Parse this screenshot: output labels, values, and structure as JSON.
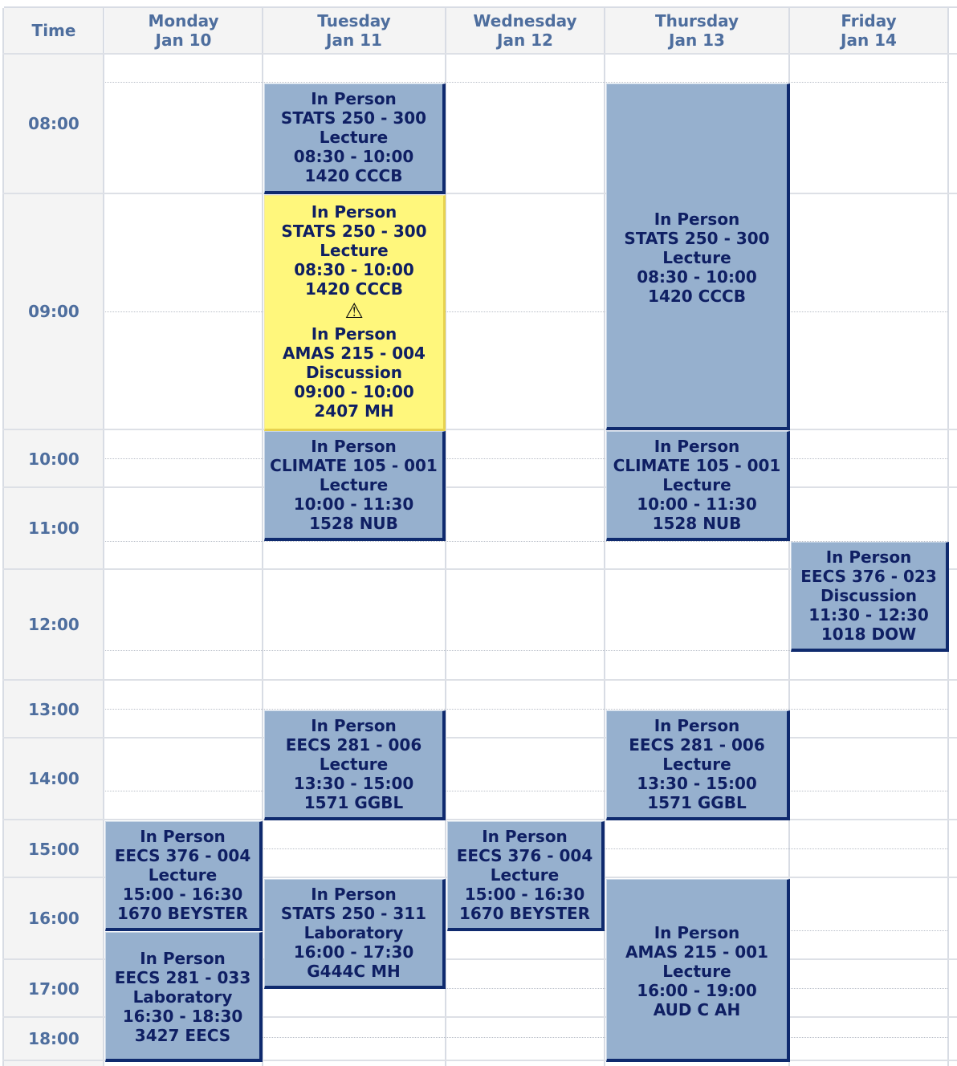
{
  "header": {
    "time_label": "Time",
    "days": [
      {
        "name": "Monday",
        "date": "Jan 10"
      },
      {
        "name": "Tuesday",
        "date": "Jan 11"
      },
      {
        "name": "Wednesday",
        "date": "Jan 12"
      },
      {
        "name": "Thursday",
        "date": "Jan 13"
      },
      {
        "name": "Friday",
        "date": "Jan 14"
      }
    ]
  },
  "time_labels": [
    "08:00",
    "09:00",
    "10:00",
    "11:00",
    "12:00",
    "13:00",
    "14:00",
    "15:00",
    "16:00",
    "17:00",
    "18:00"
  ],
  "events": [
    {
      "mode": "In Person",
      "course": "STATS 250 - 300",
      "type": "Lecture",
      "time": "08:30 - 10:00",
      "room": "1420 CCCB"
    },
    {
      "mode": "In Person",
      "course": "STATS 250 - 300",
      "type": "Lecture",
      "time": "08:30 - 10:00",
      "room": "1420 CCCB"
    },
    {
      "mode": "In Person",
      "course": "STATS 250 - 300",
      "type": "Lecture",
      "time": "08:30 - 10:00",
      "room": "1420 CCCB"
    },
    {
      "mode": "In Person",
      "course": "AMAS 215 - 004",
      "type": "Discussion",
      "time": "09:00 - 10:00",
      "room": "2407 MH"
    },
    {
      "mode": "In Person",
      "course": "CLIMATE 105 - 001",
      "type": "Lecture",
      "time": "10:00 - 11:30",
      "room": "1528 NUB"
    },
    {
      "mode": "In Person",
      "course": "CLIMATE 105 - 001",
      "type": "Lecture",
      "time": "10:00 - 11:30",
      "room": "1528 NUB"
    },
    {
      "mode": "In Person",
      "course": "EECS 376 - 023",
      "type": "Discussion",
      "time": "11:30 - 12:30",
      "room": "1018 DOW"
    },
    {
      "mode": "In Person",
      "course": "EECS 281 - 006",
      "type": "Lecture",
      "time": "13:30 - 15:00",
      "room": "1571 GGBL"
    },
    {
      "mode": "In Person",
      "course": "EECS 281 - 006",
      "type": "Lecture",
      "time": "13:30 - 15:00",
      "room": "1571 GGBL"
    },
    {
      "mode": "In Person",
      "course": "EECS 376 - 004",
      "type": "Lecture",
      "time": "15:00 - 16:30",
      "room": "1670 BEYSTER"
    },
    {
      "mode": "In Person",
      "course": "EECS 376 - 004",
      "type": "Lecture",
      "time": "15:00 - 16:30",
      "room": "1670 BEYSTER"
    },
    {
      "mode": "In Person",
      "course": "STATS 250 - 311",
      "type": "Laboratory",
      "time": "16:00 - 17:30",
      "room": "G444C MH"
    },
    {
      "mode": "In Person",
      "course": "AMAS 215 - 001",
      "type": "Lecture",
      "time": "16:00 - 19:00",
      "room": "AUD C AH"
    },
    {
      "mode": "In Person",
      "course": "EECS 281 - 033",
      "type": "Laboratory",
      "time": "16:30 - 18:30",
      "room": "3427 EECS"
    }
  ],
  "conflict_icon": "warning-triangle-icon",
  "colors": {
    "event_bg": "#96b0ce",
    "event_border": "#0f2a6e",
    "event_text": "#0f1f63",
    "conflict_bg": "#fff77c",
    "header_text": "#4e6e9e"
  }
}
